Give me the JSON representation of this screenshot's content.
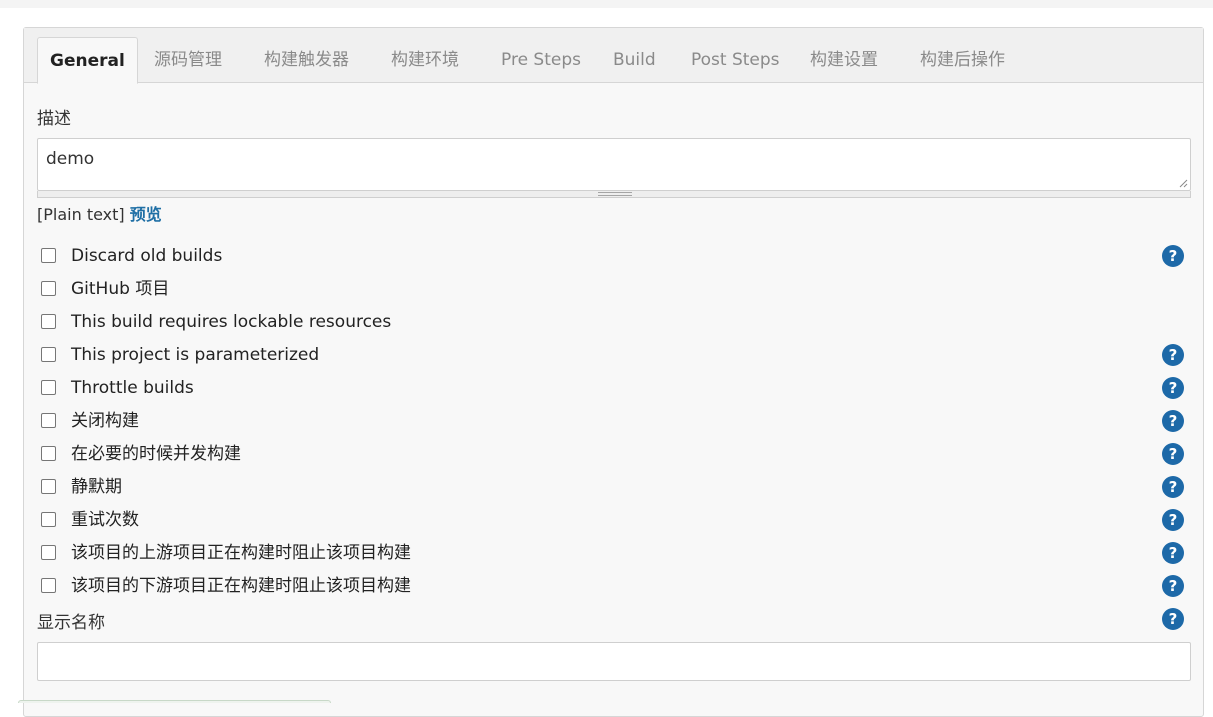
{
  "tabs": [
    {
      "label": "General",
      "active": true
    },
    {
      "label": "源码管理"
    },
    {
      "label": "构建触发器"
    },
    {
      "label": "构建环境"
    },
    {
      "label": "Pre Steps"
    },
    {
      "label": "Build"
    },
    {
      "label": "Post Steps"
    },
    {
      "label": "构建设置"
    },
    {
      "label": "构建后操作"
    }
  ],
  "description": {
    "label": "描述",
    "value": "demo",
    "format_text": "[Plain text]",
    "preview_label": "预览"
  },
  "options": [
    {
      "label": "Discard old builds",
      "checked": false,
      "help": true
    },
    {
      "label": "GitHub 项目",
      "checked": false,
      "help": false
    },
    {
      "label": "This build requires lockable resources",
      "checked": false,
      "help": false
    },
    {
      "label": "This project is parameterized",
      "checked": false,
      "help": true
    },
    {
      "label": "Throttle builds",
      "checked": false,
      "help": true
    },
    {
      "label": "关闭构建",
      "checked": false,
      "help": true
    },
    {
      "label": "在必要的时候并发构建",
      "checked": false,
      "help": true
    },
    {
      "label": "静默期",
      "checked": false,
      "help": true
    },
    {
      "label": "重试次数",
      "checked": false,
      "help": true
    },
    {
      "label": "该项目的上游项目正在构建时阻止该项目构建",
      "checked": false,
      "help": true
    },
    {
      "label": "该项目的下游项目正在构建时阻止该项目构建",
      "checked": false,
      "help": true
    }
  ],
  "display_name": {
    "label": "显示名称",
    "value": ""
  },
  "help_glyph": "?",
  "icons": {
    "help": "question-circle-icon",
    "resize": "resize-grip-icon"
  },
  "colors": {
    "accent": "#1d69a8",
    "link": "#1f6fa5"
  }
}
